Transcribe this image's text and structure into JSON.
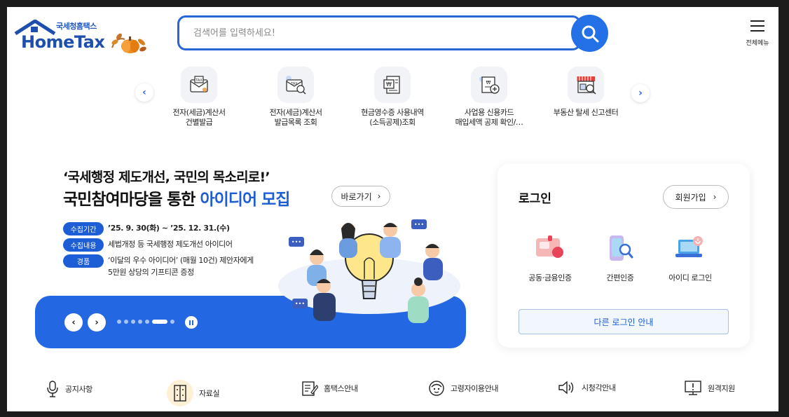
{
  "header": {
    "logo_small": "국세청홈택스",
    "logo_big": "HomeTax",
    "search_placeholder": "검색어를 입력하세요!",
    "menu_label": "전체메뉴"
  },
  "quick_menu": [
    {
      "line1": "전자(세금)계산서",
      "line2": "건별발급",
      "icon": "tax-invoice-envelope-icon"
    },
    {
      "line1": "전자(세금)계산서",
      "line2": "발급목록 조회",
      "icon": "tax-invoice-search-icon"
    },
    {
      "line1": "현금영수증 사용내역",
      "line2": "(소득공제)조회",
      "icon": "cash-receipt-icon"
    },
    {
      "line1": "사업용 신용카드",
      "line2": "매입세액 공제 확인/…",
      "icon": "credit-card-deduction-icon"
    },
    {
      "line1": "부동산 탈세 신고센터",
      "line2": "",
      "icon": "real-estate-report-icon"
    }
  ],
  "banner": {
    "quote": "‘국세행정 제도개선, 국민의 목소리로!’",
    "title_main": "국민참여마당을 통한 ",
    "title_accent": "아이디어 모집",
    "go_button": "바로가기",
    "rows": [
      {
        "tag": "수집기간",
        "text": "’25. 9. 30(화) ~ ’25. 12. 31.(수)",
        "text2": ""
      },
      {
        "tag": "수집내용",
        "text": "세법개정 등 국세행정 제도개선 아이디어",
        "text2": ""
      },
      {
        "tag": "경품",
        "text": "‘이달의 우수 아이디어’ (매월 10건) 제안자에게",
        "text2": "5만원 상당의 기프티콘 증정"
      }
    ],
    "dots_count": 7,
    "active_dot": 5
  },
  "login": {
    "title": "로그인",
    "signup": "회원가입",
    "options": [
      {
        "label": "공동·금융인증",
        "icon": "certificate-icon"
      },
      {
        "label": "간편인증",
        "icon": "simple-auth-phone-icon"
      },
      {
        "label": "아이디 로그인",
        "icon": "id-login-laptop-icon"
      }
    ],
    "other": "다른 로그인 안내"
  },
  "bottom_links": [
    {
      "label": "공지사항",
      "icon": "microphone-icon"
    },
    {
      "label": "자료실",
      "icon": "archive-cabinet-icon"
    },
    {
      "label": "홈택스안내",
      "icon": "guide-document-icon"
    },
    {
      "label": "고령자이용안내",
      "icon": "senior-face-icon"
    },
    {
      "label": "시청각안내",
      "icon": "speaker-icon"
    },
    {
      "label": "원격지원",
      "icon": "remote-support-monitor-icon"
    }
  ],
  "colors": {
    "accent": "#1d5ed6",
    "band": "#2367e3",
    "search_border": "#2766d8"
  }
}
